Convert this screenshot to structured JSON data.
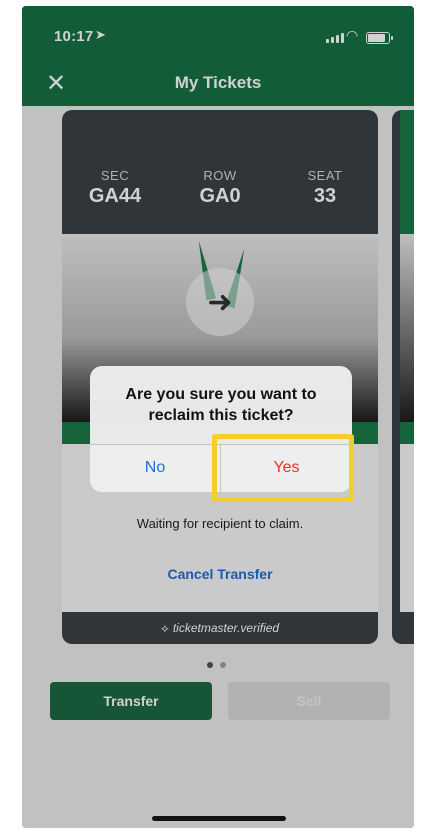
{
  "status_bar": {
    "time": "10:17",
    "location_icon": "location-arrow-icon"
  },
  "nav": {
    "title": "My Tickets",
    "close_glyph": "✕"
  },
  "ticket": {
    "sec_label": "SEC",
    "sec_value": "GA44",
    "row_label": "ROW",
    "row_value": "GA0",
    "seat_label": "SEAT",
    "seat_value": "33",
    "status_text": "Waiting for recipient to claim.",
    "cancel_label": "Cancel Transfer",
    "footer_text": "ticketmaster.verified"
  },
  "dialog": {
    "message": "Are you sure you want to reclaim this ticket?",
    "no_label": "No",
    "yes_label": "Yes"
  },
  "actions": {
    "transfer_label": "Transfer",
    "sell_label": "Sell"
  },
  "colors": {
    "brand_green": "#1b7a4a",
    "link_blue": "#1f6fd6",
    "destructive_red": "#e2332e",
    "highlight_yellow": "#f5cd2d"
  }
}
